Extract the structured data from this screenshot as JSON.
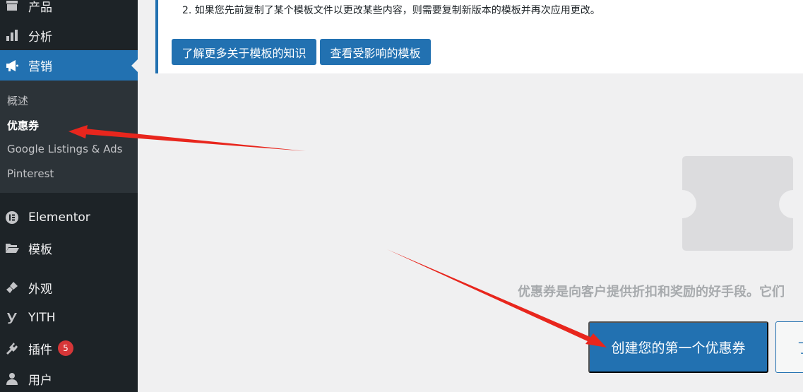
{
  "sidebar": {
    "items": [
      {
        "label": "产品",
        "icon": "archive-icon"
      },
      {
        "label": "分析",
        "icon": "bar-chart-icon"
      },
      {
        "label": "营销",
        "icon": "megaphone-icon"
      },
      {
        "label": "Elementor",
        "icon": "elementor-icon"
      },
      {
        "label": "模板",
        "icon": "folder-open-icon"
      },
      {
        "label": "外观",
        "icon": "paintbrush-icon"
      },
      {
        "label": "YITH",
        "icon": "yith-icon"
      },
      {
        "label": "插件",
        "icon": "plugin-icon",
        "badge": "5"
      },
      {
        "label": "用户",
        "icon": "user-icon"
      }
    ],
    "submenu": [
      "概述",
      "优惠券",
      "Google Listings & Ads",
      "Pinterest"
    ]
  },
  "notice": {
    "text": "2. 如果您先前复制了某个模板文件以更改某些内容，则需要复制新版本的模板并再次应用更改。",
    "learn_more_label": "了解更多关于模板的知识",
    "view_affected_label": "查看受影响的模板"
  },
  "empty_state": {
    "message": "优惠券是向客户提供折扣和奖励的好手段。它们",
    "create_button": "创建您的第一个优惠券",
    "secondary_button": "了"
  },
  "colors": {
    "sidebar_bg": "#1d2327",
    "accent": "#2271b1",
    "annotation_arrow": "#e8261d"
  }
}
